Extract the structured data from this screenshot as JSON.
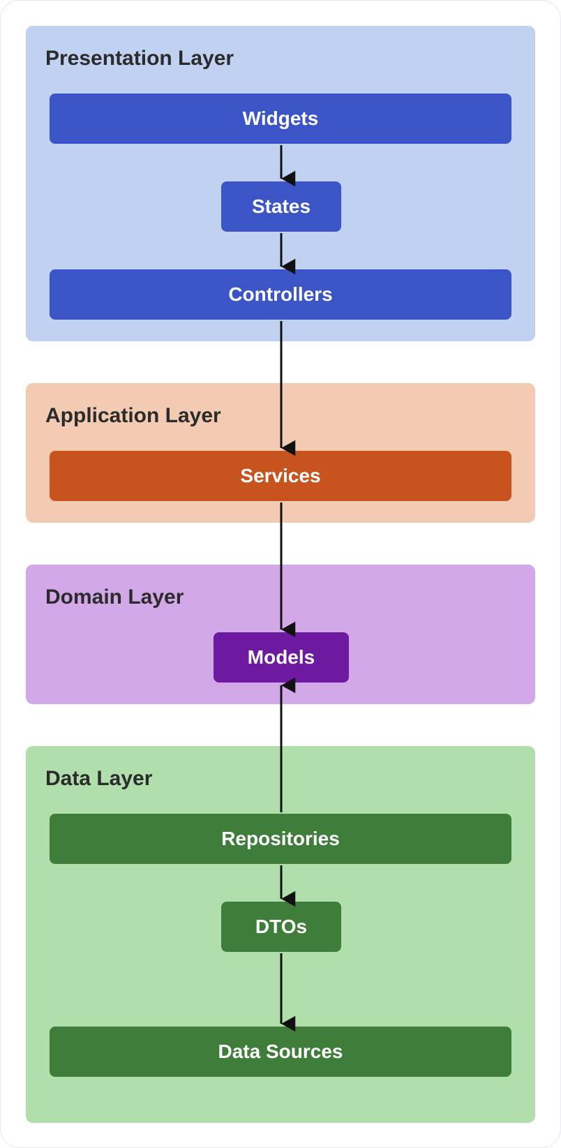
{
  "layers": {
    "presentation": {
      "title": "Presentation Layer",
      "bg": "#c1d1f1",
      "node_bg": "#3b55c6",
      "nodes": {
        "widgets": "Widgets",
        "states": "States",
        "controllers": "Controllers"
      }
    },
    "application": {
      "title": "Application Layer",
      "bg": "#f3cbb3",
      "node_bg": "#c7541f",
      "nodes": {
        "services": "Services"
      }
    },
    "domain": {
      "title": "Domain Layer",
      "bg": "#d3a8e8",
      "node_bg": "#6e1aa0",
      "nodes": {
        "models": "Models"
      }
    },
    "data": {
      "title": "Data Layer",
      "bg": "#b0dfab",
      "node_bg": "#3f7d3a",
      "nodes": {
        "repositories": "Repositories",
        "dtos": "DTOs",
        "data_sources": "Data Sources"
      }
    }
  },
  "arrows": [
    {
      "from": "widgets",
      "to": "states",
      "direction": "down"
    },
    {
      "from": "states",
      "to": "controllers",
      "direction": "down"
    },
    {
      "from": "controllers",
      "to": "services",
      "direction": "down"
    },
    {
      "from": "services",
      "to": "models",
      "direction": "down"
    },
    {
      "from": "repositories",
      "to": "models",
      "direction": "up"
    },
    {
      "from": "repositories",
      "to": "dtos",
      "direction": "down"
    },
    {
      "from": "dtos",
      "to": "data_sources",
      "direction": "down"
    }
  ]
}
